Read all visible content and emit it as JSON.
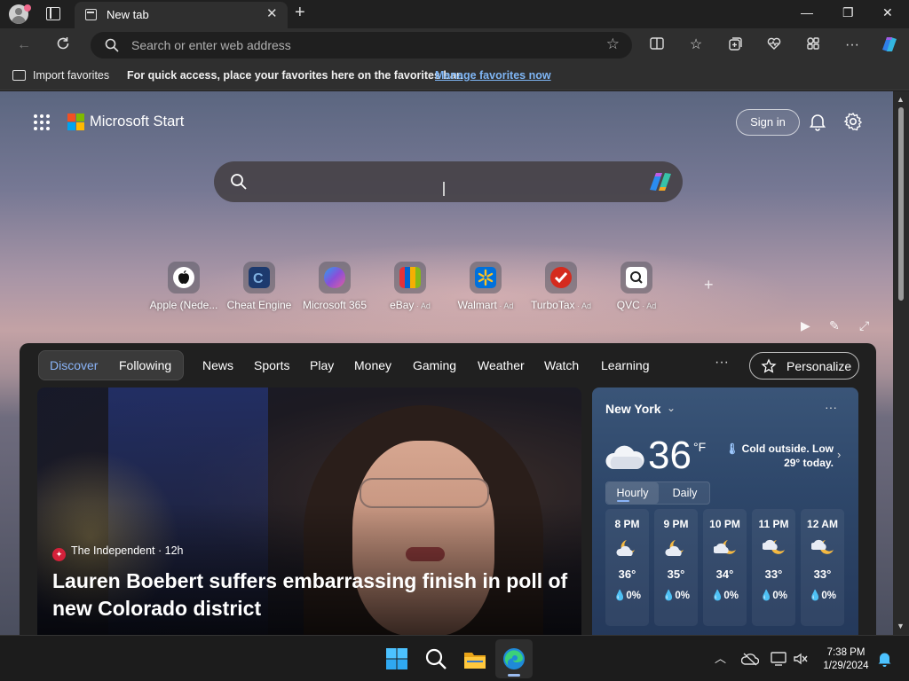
{
  "browser": {
    "tab_title": "New tab",
    "address_placeholder": "Search or enter web address",
    "favorites_bar": {
      "import_label": "Import favorites",
      "message": "For quick access, place your favorites here on the favorites bar.",
      "link": "Manage favorites now"
    }
  },
  "start": {
    "brand": "Microsoft Start",
    "sign_in": "Sign in",
    "quick_links": [
      {
        "name": "Apple (Nede...",
        "ad": "",
        "icon": "apple-icon",
        "color": "#ffffff"
      },
      {
        "name": "Cheat Engine",
        "ad": "",
        "icon": "cheat-engine-icon",
        "color": "#1d3a6e"
      },
      {
        "name": "Microsoft 365",
        "ad": "",
        "icon": "microsoft-365-icon",
        "color": "#6a4fd8"
      },
      {
        "name": "eBay",
        "ad": " · Ad",
        "icon": "ebay-icon",
        "color": "#e53238"
      },
      {
        "name": "Walmart",
        "ad": " · Ad",
        "icon": "walmart-icon",
        "color": "#0071dc"
      },
      {
        "name": "TurboTax",
        "ad": " · Ad",
        "icon": "turbotax-icon",
        "color": "#d52b1e"
      },
      {
        "name": "QVC",
        "ad": " · Ad",
        "icon": "qvc-icon",
        "color": "#ffffff"
      }
    ],
    "feed_tabs": {
      "discover": "Discover",
      "following": "Following"
    },
    "nav": [
      "News",
      "Sports",
      "Play",
      "Money",
      "Gaming",
      "Weather",
      "Watch",
      "Learning"
    ],
    "personalize": "Personalize",
    "hero": {
      "source": "The Independent · 12h",
      "headline": "Lauren Boebert suffers embarrassing finish in poll of new Colorado district"
    },
    "weather": {
      "city": "New York",
      "temp": "36",
      "unit": "°F",
      "description": "Cold outside. Low 29° today.",
      "mode_hourly": "Hourly",
      "mode_daily": "Daily",
      "hours": [
        {
          "time": "8 PM",
          "temp": "36°",
          "precip": "0%",
          "icon": "partly-cloudy-moon-icon"
        },
        {
          "time": "9 PM",
          "temp": "35°",
          "precip": "0%",
          "icon": "partly-cloudy-moon-icon"
        },
        {
          "time": "10 PM",
          "temp": "34°",
          "precip": "0%",
          "icon": "partly-cloudy-moon-icon"
        },
        {
          "time": "11 PM",
          "temp": "33°",
          "precip": "0%",
          "icon": "partly-cloudy-moon-icon"
        },
        {
          "time": "12 AM",
          "temp": "33°",
          "precip": "0%",
          "icon": "partly-cloudy-moon-icon"
        }
      ]
    }
  },
  "taskbar": {
    "time": "7:38 PM",
    "date": "1/29/2024"
  }
}
